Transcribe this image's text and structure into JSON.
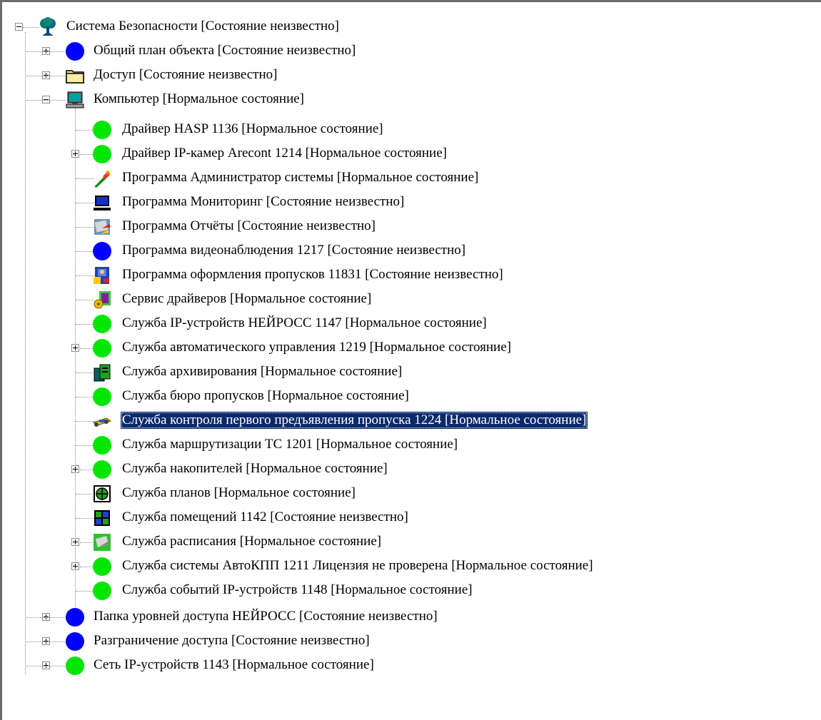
{
  "tree": {
    "root": {
      "label": "Система Безопасности [Состояние неизвестно]",
      "icon": "tree-icon"
    },
    "level1_top": [
      {
        "label": "Общий план объекта [Состояние неизвестно]",
        "icon": "blue-circle-icon"
      },
      {
        "label": "Доступ [Состояние неизвестно]",
        "icon": "folder-icon"
      },
      {
        "label": "Компьютер [Нормальное состояние]",
        "icon": "computer-icon"
      }
    ],
    "computer_children": [
      {
        "label": "Драйвер HASP 1136 [Нормальное состояние]",
        "icon": "green-circle-icon"
      },
      {
        "label": "Драйвер IP-камер Arecont 1214 [Нормальное состояние]",
        "icon": "green-circle-icon"
      },
      {
        "label": "Программа Администратор системы [Нормальное состояние]",
        "icon": "admin-torch-icon"
      },
      {
        "label": "Программа Мониторинг [Состояние неизвестно]",
        "icon": "monitor-icon"
      },
      {
        "label": "Программа Отчёты [Состояние неизвестно]",
        "icon": "reports-icon"
      },
      {
        "label": "Программа видеонаблюдения 1217 [Состояние неизвестно]",
        "icon": "blue-circle-icon"
      },
      {
        "label": "Программа оформления пропусков 11831 [Состояние неизвестно]",
        "icon": "pass-design-icon"
      },
      {
        "label": "Сервис драйверов [Нормальное состояние]",
        "icon": "driver-service-icon"
      },
      {
        "label": "Служба IP-устройств НЕЙРОСС 1147 [Нормальное состояние]",
        "icon": "green-circle-icon"
      },
      {
        "label": "Служба автоматического управления 1219 [Нормальное состояние]",
        "icon": "green-circle-icon"
      },
      {
        "label": "Служба архивирования [Нормальное состояние]",
        "icon": "archive-icon"
      },
      {
        "label": "Служба бюро пропусков [Нормальное состояние]",
        "icon": "green-circle-icon"
      },
      {
        "label": "Служба контроля первого предъявления пропуска 1224 [Нормальное состояние]",
        "icon": "pass-control-icon"
      },
      {
        "label": "Служба маршрутизации ТС 1201 [Нормальное состояние]",
        "icon": "green-circle-icon"
      },
      {
        "label": "Служба накопителей [Нормальное состояние]",
        "icon": "green-circle-icon"
      },
      {
        "label": "Служба планов [Нормальное состояние]",
        "icon": "plans-icon"
      },
      {
        "label": "Служба помещений 1142 [Состояние неизвестно]",
        "icon": "rooms-icon"
      },
      {
        "label": "Служба расписания [Нормальное состояние]",
        "icon": "schedule-icon"
      },
      {
        "label": "Служба системы АвтоКПП 1211 Лицензия не проверена [Нормальное состояние]",
        "icon": "green-circle-icon"
      },
      {
        "label": "Служба событий IP-устройств 1148 [Нормальное состояние]",
        "icon": "green-circle-icon"
      }
    ],
    "level1_bottom": [
      {
        "label": "Папка уровней доступа НЕЙРОСС [Состояние неизвестно]",
        "icon": "blue-circle-icon"
      },
      {
        "label": "Разграничение доступа [Состояние неизвестно]",
        "icon": "blue-circle-icon"
      },
      {
        "label": "Сеть IP-устройств 1143 [Нормальное состояние]",
        "icon": "green-circle-icon"
      }
    ]
  },
  "colors": {
    "status_normal": "#00e600",
    "status_unknown": "#0000ff",
    "selection": "#0b2a6b"
  }
}
